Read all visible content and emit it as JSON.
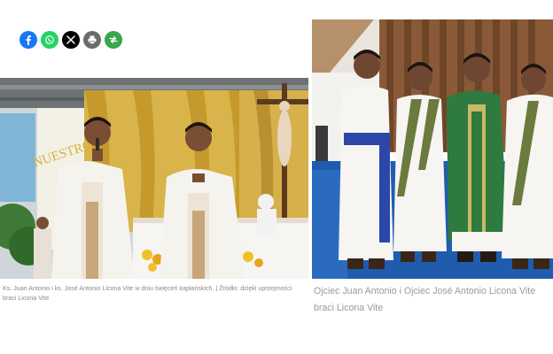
{
  "share": {
    "buttons": [
      {
        "icon": "facebook-icon",
        "color": "#1877F2"
      },
      {
        "icon": "whatsapp-icon",
        "color": "#25D366"
      },
      {
        "icon": "x-icon",
        "color": "#000000"
      },
      {
        "icon": "print-icon",
        "color": "#6b6b6b"
      },
      {
        "icon": "share-more-icon",
        "color": "#3aa64c"
      }
    ]
  },
  "photos": {
    "left": {
      "banner_text": "NUESTRO"
    },
    "right": {}
  },
  "captions": {
    "left": {
      "text": "Ks. Juan Antonio i ks. José Antonio Licona Vite w dniu święceń kapłańskich. | Źródło: dzięki uprzejmości",
      "text_line2": "braci Licona Vite"
    },
    "right": {
      "line1": "Ojciec Juan Antonio i Ojciec José Antonio Licona Vite",
      "line2": "braci Licona Vite"
    }
  }
}
